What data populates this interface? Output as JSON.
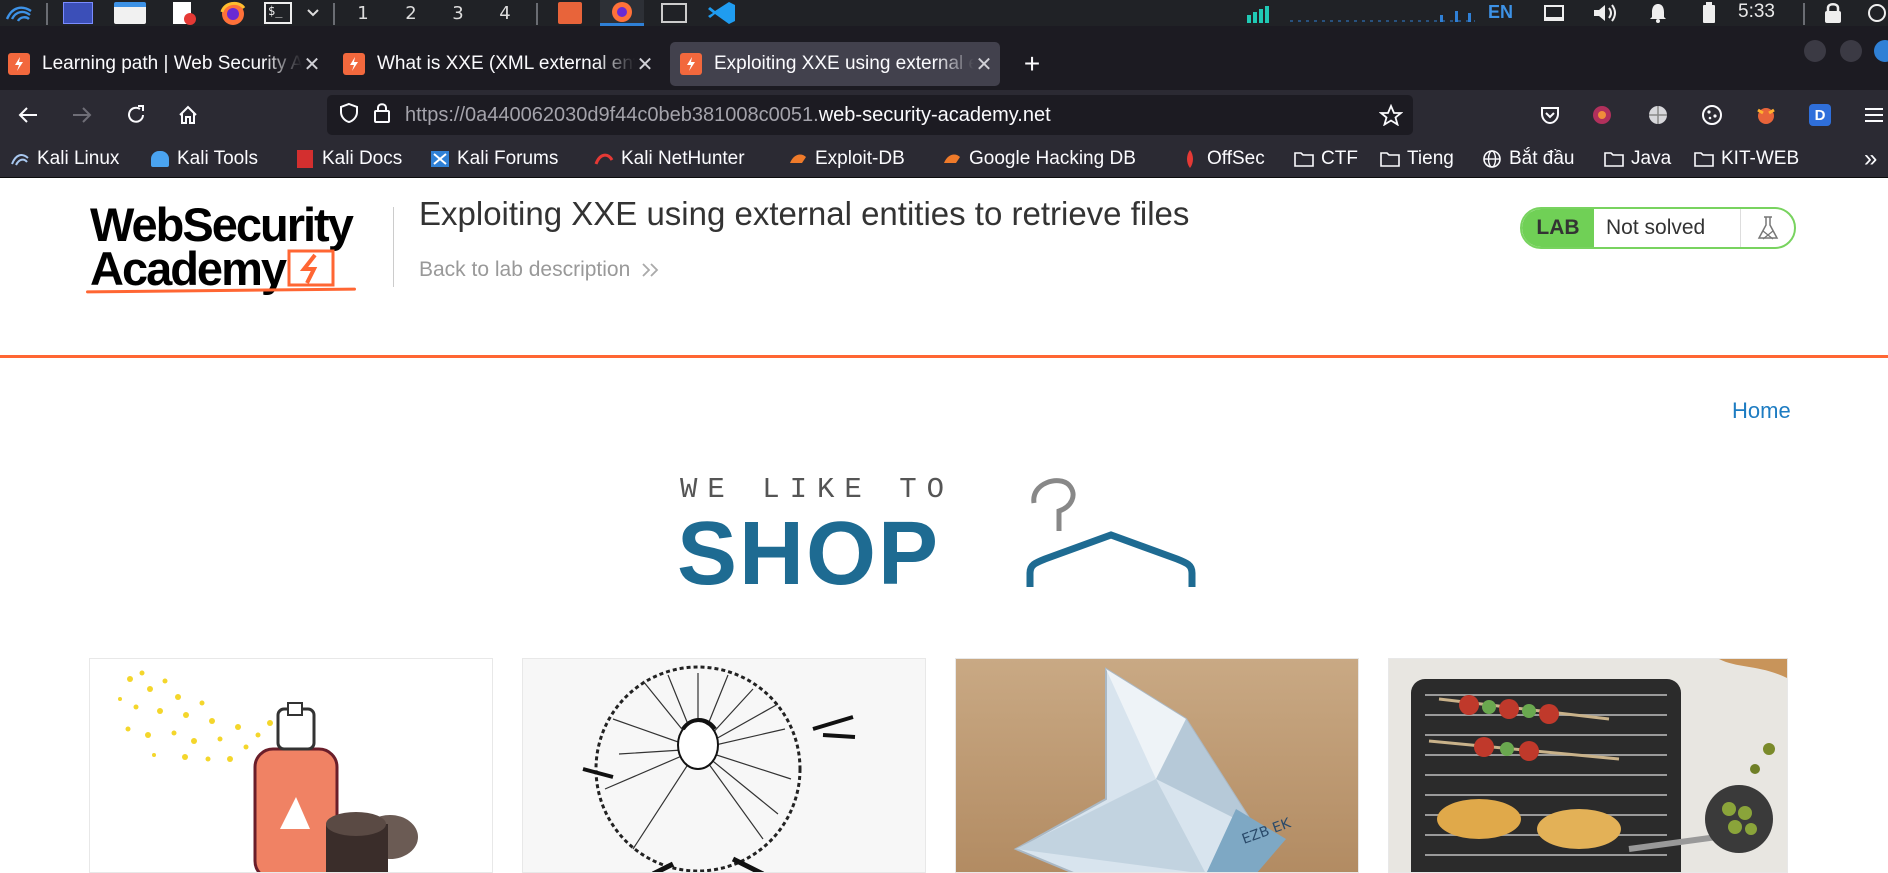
{
  "os_panel": {
    "workspaces": [
      "1",
      "2",
      "3",
      "4"
    ],
    "active_workspace": "1",
    "language": "EN",
    "clock": "5:33",
    "icons": [
      "kali-menu-icon",
      "show-desktop-icon",
      "file-manager-icon",
      "text-editor-icon",
      "firefox-icon",
      "terminal-icon",
      "launcher-chevron-icon",
      "burp-window-icon",
      "firefox-window-icon",
      "terminal-window-icon",
      "vscode-window-icon",
      "cpu-graph-icon",
      "network-graph-icon",
      "display-icon",
      "volume-icon",
      "notification-bell-icon",
      "power-icon",
      "lock-icon"
    ]
  },
  "browser": {
    "tabs": [
      {
        "title": "Learning path | Web Security Academy",
        "active": false
      },
      {
        "title": "What is XXE (XML external entity) injection?",
        "active": false
      },
      {
        "title": "Exploiting XXE using external entities to retrieve files",
        "active": true
      }
    ],
    "url_prefix": "https://0a440062030d9f44c0beb381008c0051.",
    "url_domain": "web-security-academy.net",
    "bookmarks": [
      {
        "label": "Kali Linux",
        "icon": "kali-icon"
      },
      {
        "label": "Kali Tools",
        "icon": "kali-tools-icon"
      },
      {
        "label": "Kali Docs",
        "icon": "kali-docs-icon"
      },
      {
        "label": "Kali Forums",
        "icon": "kali-forums-icon"
      },
      {
        "label": "Kali NetHunter",
        "icon": "nethunter-icon"
      },
      {
        "label": "Exploit-DB",
        "icon": "exploit-db-icon"
      },
      {
        "label": "Google Hacking DB",
        "icon": "ghdb-icon"
      },
      {
        "label": "OffSec",
        "icon": "offsec-icon"
      },
      {
        "label": "CTF",
        "icon": "folder-icon"
      },
      {
        "label": "Tieng",
        "icon": "folder-icon"
      },
      {
        "label": "Bắt đầu",
        "icon": "globe-icon"
      },
      {
        "label": "Java",
        "icon": "folder-icon"
      },
      {
        "label": "KIT-WEB",
        "icon": "folder-icon"
      }
    ],
    "overflow_label": "»"
  },
  "academy": {
    "logo_line1": "WebSecurity",
    "logo_line2": "Academy",
    "lab_title": "Exploiting XXE using external entities to retrieve files",
    "back_link": "Back to lab description",
    "status_tag": "LAB",
    "status_text": "Not solved",
    "accent": "#ff6633"
  },
  "shop": {
    "home_link": "Home",
    "banner_small": "WE LIKE TO",
    "banner_big": "SHOP",
    "brand_color": "#1e6b92",
    "products": [
      {
        "name": "spray-can-product"
      },
      {
        "name": "sun-man-product"
      },
      {
        "name": "paper-bird-product"
      },
      {
        "name": "bbq-grill-product"
      }
    ]
  }
}
